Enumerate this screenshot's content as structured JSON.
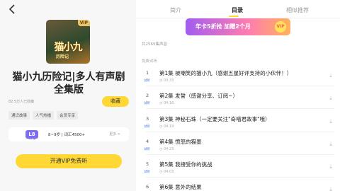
{
  "left": {
    "cover": {
      "vip_badge": "VIP",
      "title_art": "猫小九",
      "subtitle_art": "历险记"
    },
    "title": "猫小九历险记|多人有声剧全集版",
    "plays": "82.5万人已收藏",
    "collect_label": "收藏",
    "tags": [
      "通识故事",
      "人气热播",
      "会员专享"
    ],
    "level": {
      "badge": "L8",
      "badge_sub": "词汇量",
      "text": "8~9岁 | 词汇4500+",
      "more": "更多 >"
    },
    "vip_button": "开通VIP免费听"
  },
  "tabs": [
    "简介",
    "目录",
    "相似推荐"
  ],
  "active_tab": "目录",
  "banner": {
    "text": "年卡5折抢 加赠2个月",
    "badge": "VIP"
  },
  "total": "共2565集声音",
  "free_label": "免费试听",
  "episodes": [
    {
      "num": "1",
      "trial": "试听",
      "title": "第1集 被嘲笑的猫小九（感谢五星好评支持的小伙伴！）",
      "duration": "03:33"
    },
    {
      "num": "2",
      "trial": "试听",
      "title": "第2集 发誓（感谢分享、订阅~）",
      "duration": "04:16"
    },
    {
      "num": "3",
      "trial": "试听",
      "title": "第3集 神秘石珠（一定要关注\"奇喵君故事\"哦）",
      "duration": "04:19"
    },
    {
      "num": "4",
      "trial": "试听",
      "title": "第4集 愤怒的猫墨",
      "duration": "04:23"
    },
    {
      "num": "5",
      "trial": "试听",
      "title": "第5集 我接受你的挑战",
      "duration": "04:03"
    },
    {
      "num": "6",
      "trial": "试听",
      "title": "第6集 意外的结果",
      "duration": ""
    }
  ],
  "colors": {
    "accent": "#ffd836",
    "trial": "#4a7bd9",
    "level": "#7b6cf0"
  }
}
